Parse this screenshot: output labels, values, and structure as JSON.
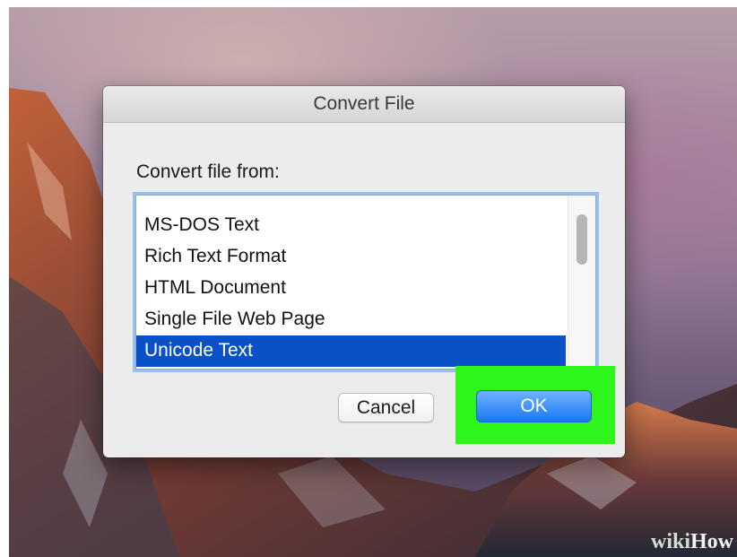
{
  "dialog": {
    "title": "Convert File",
    "prompt": "Convert file from:",
    "formats": [
      {
        "label": "MS-DOS Text",
        "selected": false
      },
      {
        "label": "Rich Text Format",
        "selected": false
      },
      {
        "label": "HTML Document",
        "selected": false
      },
      {
        "label": "Single File Web Page",
        "selected": false
      },
      {
        "label": "Unicode Text",
        "selected": true
      }
    ],
    "cancel_label": "Cancel",
    "ok_label": "OK"
  },
  "watermark": {
    "part1": "wiki",
    "part2": "How"
  },
  "colors": {
    "selection": "#0a50c6",
    "ok_button": "#1b78f2",
    "highlight_box": "#2ef51a",
    "focus_ring": "#9cc0ee"
  }
}
